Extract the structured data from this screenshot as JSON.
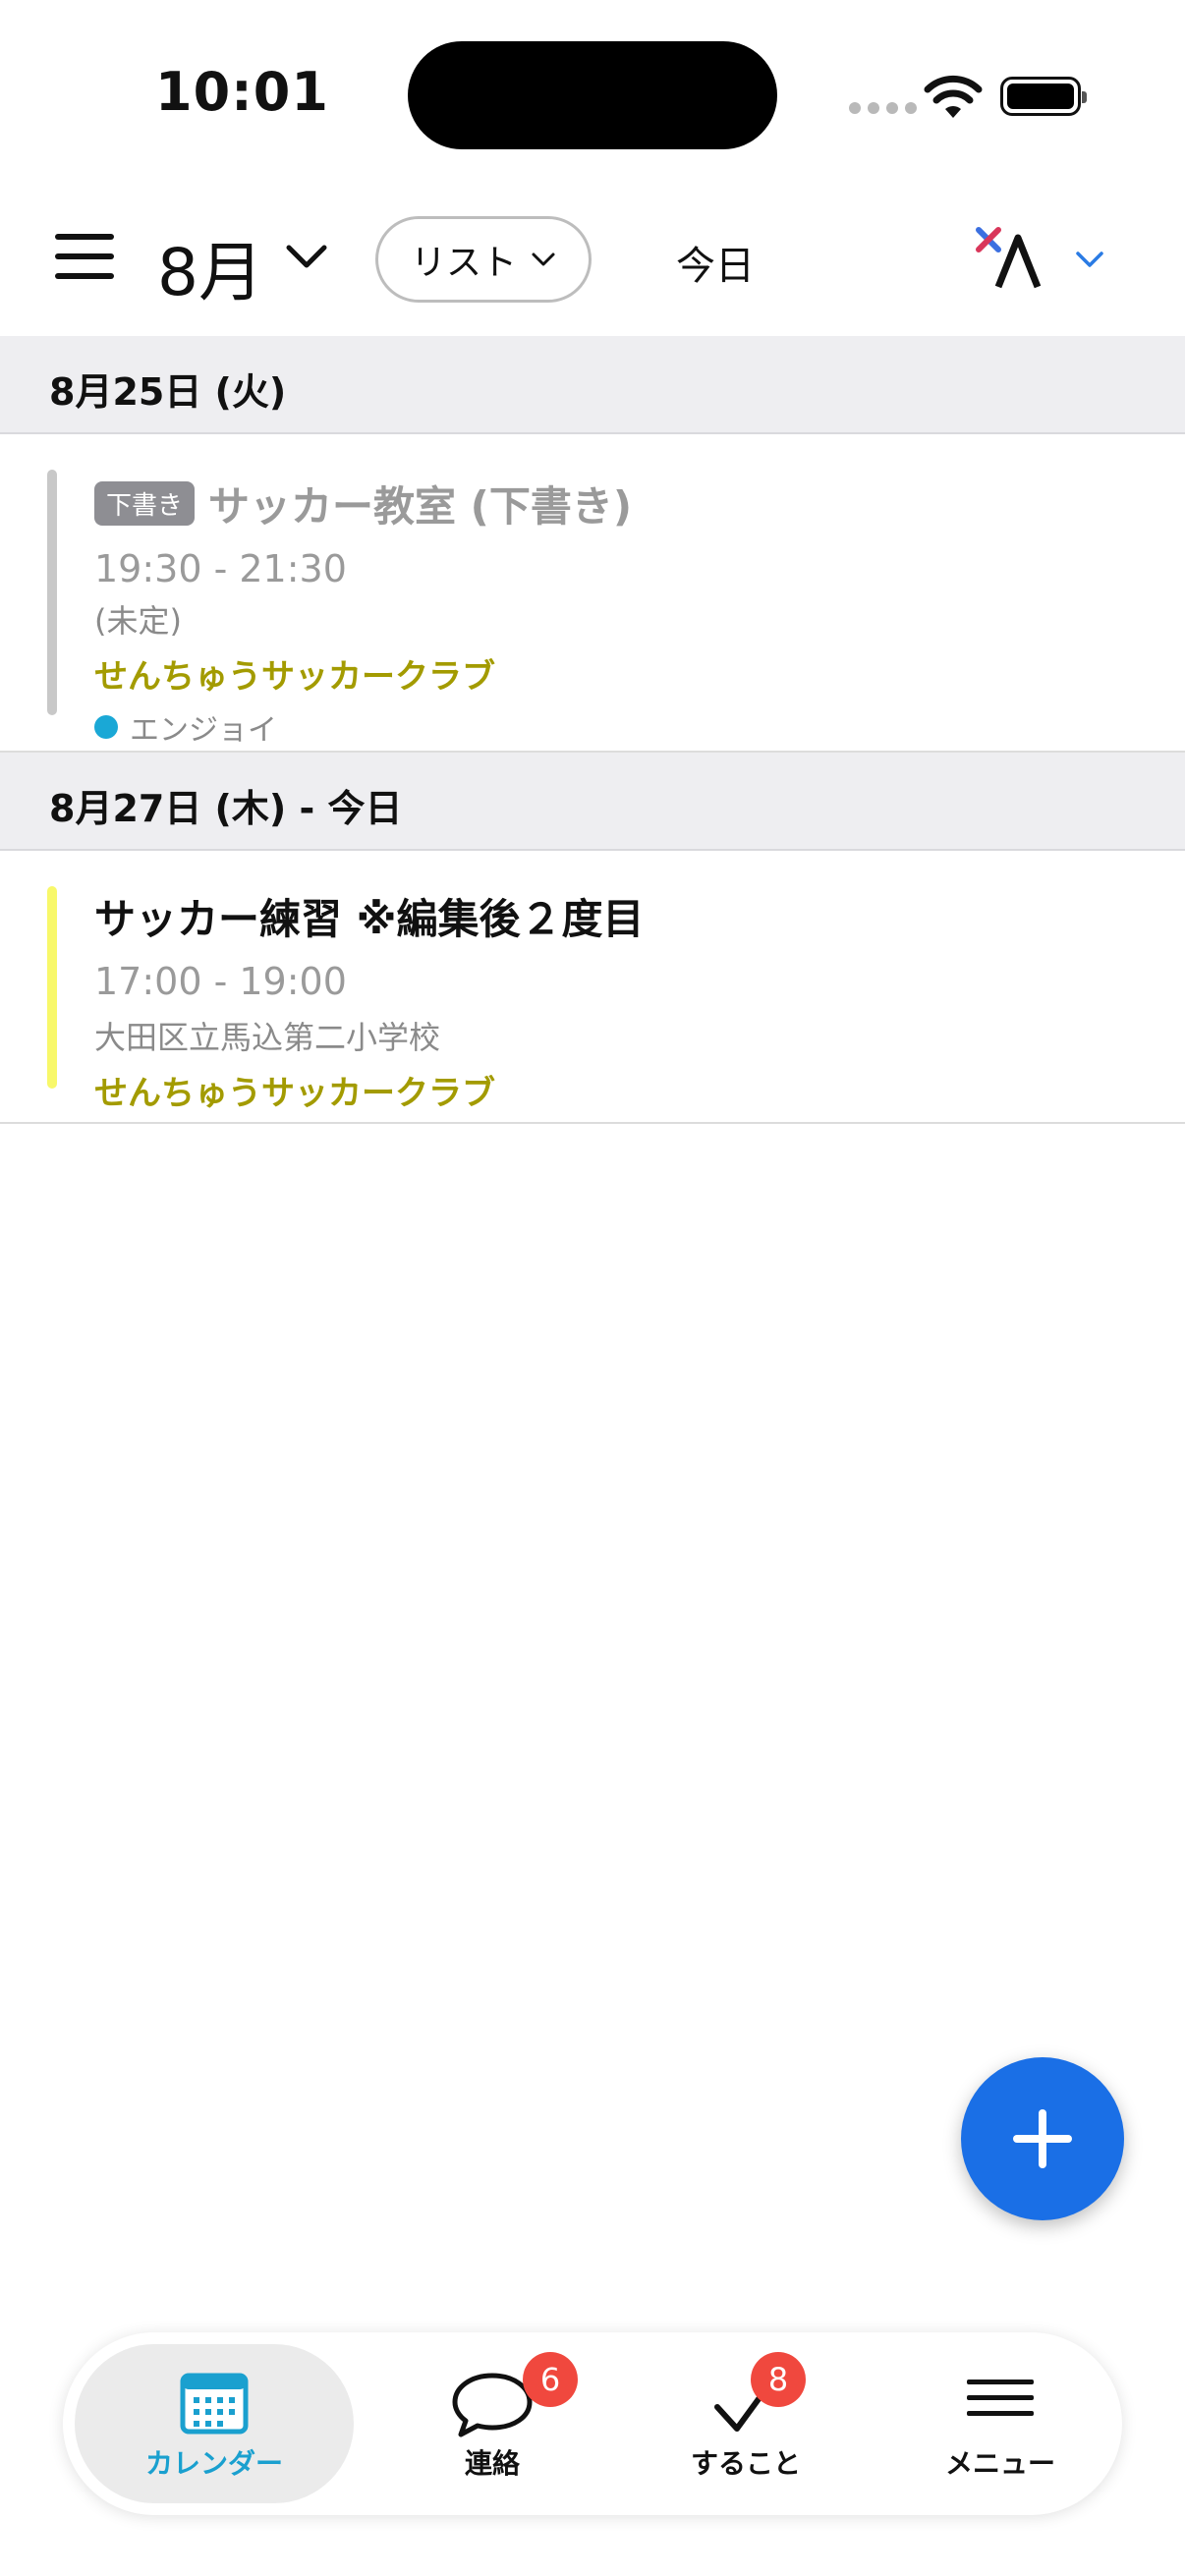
{
  "status_bar": {
    "time": "10:01"
  },
  "header": {
    "month": "8月",
    "view_mode": "リスト",
    "today": "今日"
  },
  "sections": [
    {
      "date": "8月25日 (火)",
      "events": [
        {
          "draft_badge": "下書き",
          "title": "サッカー教室 (下書き)",
          "time": "19:30 - 21:30",
          "place": "(未定)",
          "club": "せんちゅうサッカークラブ",
          "tag": "エンジョイ",
          "bar_color": "#c8c8c8",
          "tag_color": "#1aa8d6"
        }
      ]
    },
    {
      "date": "8月27日 (木) - 今日",
      "events": [
        {
          "title": "サッカー練習 ※編集後２度目",
          "time": "17:00 - 19:00",
          "place": "大田区立馬込第二小学校",
          "club": "せんちゅうサッカークラブ",
          "bar_color": "#f8f86a"
        }
      ]
    }
  ],
  "tabbar": {
    "tabs": [
      {
        "label": "カレンダー",
        "icon": "calendar-icon",
        "active": true
      },
      {
        "label": "連絡",
        "icon": "chat-bubble-icon",
        "badge": "6"
      },
      {
        "label": "すること",
        "icon": "checkmark-icon",
        "badge": "8"
      },
      {
        "label": "メニュー",
        "icon": "menu-lines-icon"
      }
    ]
  },
  "colors": {
    "accent_blue": "#1a6fe6",
    "active_tab": "#1aa0cf",
    "club_text": "#a39b00",
    "badge_red": "#f0483e"
  }
}
